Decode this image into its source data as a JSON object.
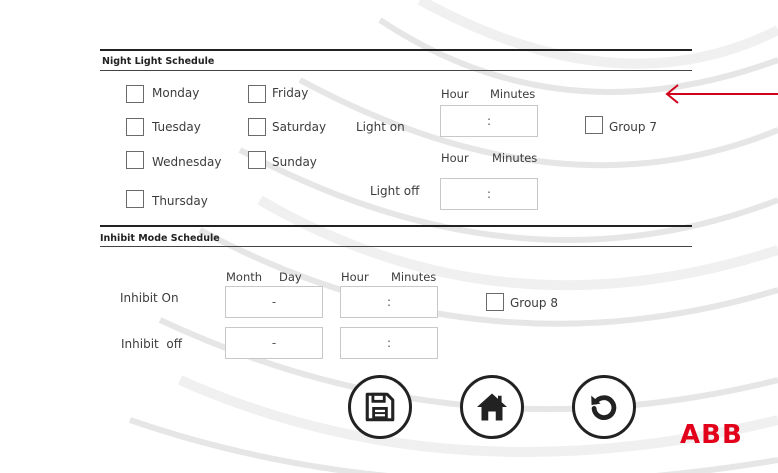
{
  "night": {
    "title": "Night Light Schedule",
    "days": [
      "Monday",
      "Friday",
      "Tuesday",
      "Saturday",
      "Wednesday",
      "Sunday",
      "Thursday"
    ],
    "hour_label": "Hour",
    "minutes_label": "Minutes",
    "light_on_label": "Light on",
    "light_off_label": "Light off",
    "light_on_value": ":",
    "light_off_value": ":",
    "group_label": "Group 7"
  },
  "inhibit": {
    "title": "Inhibit Mode Schedule",
    "month_label": "Month",
    "day_label": "Day",
    "hour_label": "Hour",
    "minutes_label": "Minutes",
    "on_label": "Inhibit On",
    "off_label": "Inhibit  off",
    "on_date_value": "-",
    "on_time_value": ":",
    "off_date_value": "-",
    "off_time_value": ":",
    "group_label": "Group 8"
  },
  "buttons": {
    "save_icon": "save-icon",
    "home_icon": "home-icon",
    "reset_icon": "undo-icon"
  },
  "brand": {
    "logo_text": "ABB",
    "color": "#e2001a"
  },
  "annotation": {
    "arrow_color": "#d0021b"
  }
}
